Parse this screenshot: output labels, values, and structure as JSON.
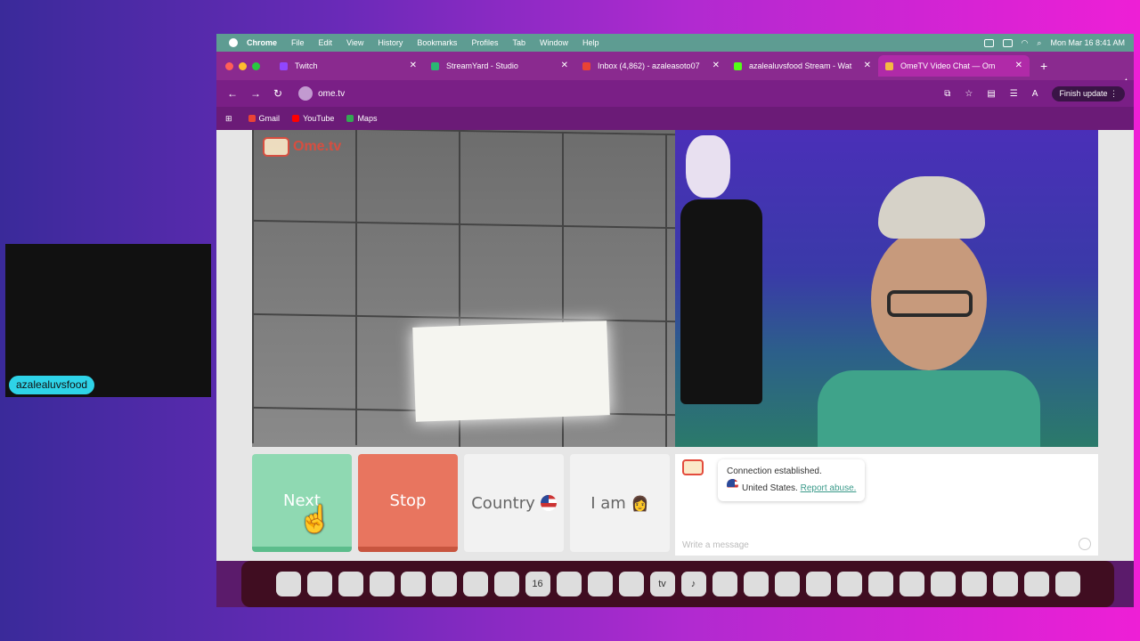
{
  "stream": {
    "name_label": "azalealuvsfood"
  },
  "menubar": {
    "app": "Chrome",
    "items": [
      "File",
      "Edit",
      "View",
      "History",
      "Bookmarks",
      "Profiles",
      "Tab",
      "Window",
      "Help"
    ],
    "clock": "Mon Mar 16  8:41 AM"
  },
  "tabs": [
    {
      "title": "Twitch",
      "color": "#9146ff"
    },
    {
      "title": "StreamYard - Studio",
      "color": "#2bb673"
    },
    {
      "title": "Inbox (4,862) - azaleasoto07",
      "color": "#ea4335"
    },
    {
      "title": "azalealuvsfood Stream - Wat",
      "color": "#53fc18"
    },
    {
      "title": "OmeTV Video Chat — Om",
      "color": "#f5b942"
    }
  ],
  "toolbar": {
    "url": "ome.tv",
    "finish_update": "Finish update",
    "profile_initial": "A"
  },
  "bookmarks": [
    {
      "label": "Gmail",
      "color": "#ea4335"
    },
    {
      "label": "YouTube",
      "color": "#ff0000"
    },
    {
      "label": "Maps",
      "color": "#34a853"
    }
  ],
  "page": {
    "logo_text": "Ome.tv",
    "buttons": {
      "next": "Next",
      "stop": "Stop",
      "country": "Country",
      "iam": "I am"
    },
    "chat": {
      "status": "Connection established.",
      "country": "United States.",
      "report": "Report abuse.",
      "placeholder": "Write a message"
    }
  },
  "dock": {
    "icons": [
      "finder-icon",
      "launchpad-icon",
      "safari-icon",
      "messages-icon",
      "mail-icon",
      "app-icon",
      "settings-icon",
      "facetime-icon",
      "calendar-icon",
      "contacts-icon",
      "notes-icon",
      "freeform-icon",
      "tv-icon",
      "music-icon",
      "capcut-icon",
      "keynote-icon",
      "numbers-icon",
      "pages-icon",
      "appstore-icon",
      "sysprefs-icon",
      "preview-icon",
      "chrome-icon",
      "spotify-icon",
      "files-icon",
      "downloads-icon",
      "trash-icon"
    ],
    "calendar_day": "16",
    "tv_label": "tv"
  },
  "colors": {
    "next": "#8fd9b2",
    "stop": "#e8755f",
    "accent": "#3a9a8a"
  }
}
